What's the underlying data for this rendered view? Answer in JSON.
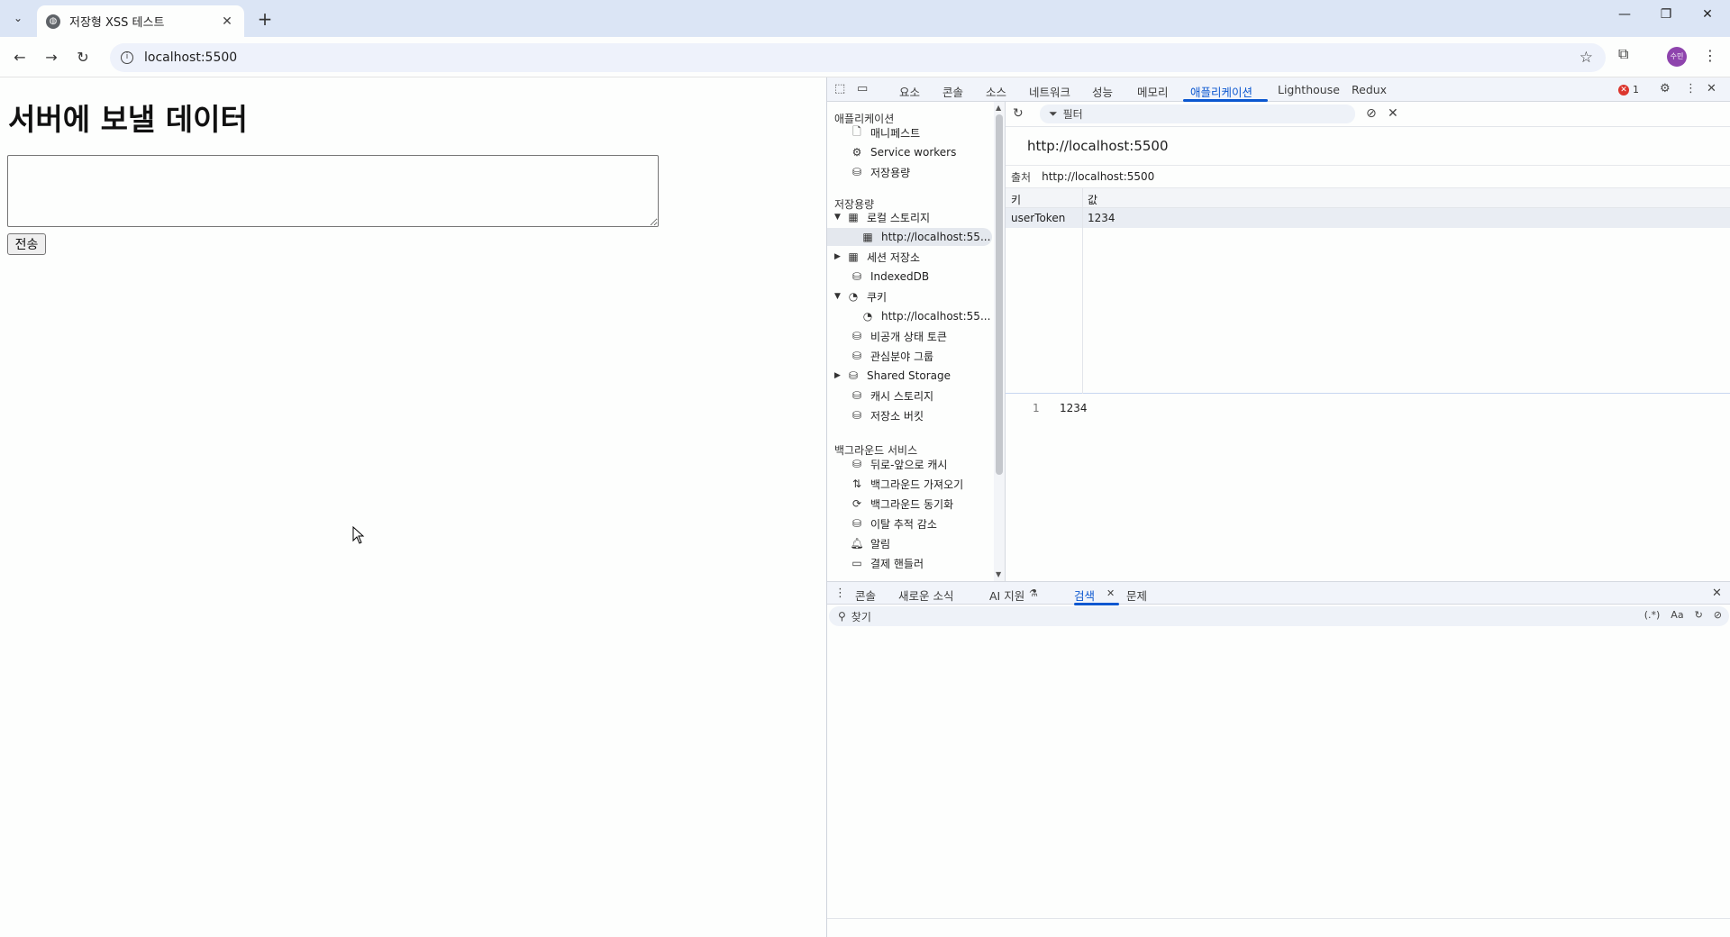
{
  "browser": {
    "tab_title": "저장형 XSS 테스트",
    "url": "localhost:5500"
  },
  "page": {
    "heading": "서버에 보낼 데이터",
    "textarea_value": "",
    "send_label": "전송"
  },
  "devtools": {
    "tabs": [
      "요소",
      "콘솔",
      "소스",
      "네트워크",
      "성능",
      "메모리",
      "애플리케이션",
      "Lighthouse",
      "Redux"
    ],
    "active_tab": "애플리케이션",
    "error_count": "1",
    "tree": {
      "section_app": "애플리케이션",
      "app_items": [
        "매니페스트",
        "Service workers",
        "저장용량"
      ],
      "section_storage": "저장용량",
      "local_storage": "로컬 스토리지",
      "local_storage_origin": "http://localhost:55...",
      "session_storage": "세션 저장소",
      "indexeddb": "IndexedDB",
      "cookies": "쿠키",
      "cookies_origin": "http://localhost:55...",
      "storage_items": [
        "비공개 상태 토큰",
        "관심분야 그룹",
        "Shared Storage",
        "캐시 스토리지",
        "저장소 버킷"
      ],
      "section_bg": "백그라운드 서비스",
      "bg_items": [
        "뒤로-앞으로 캐시",
        "백그라운드 가져오기",
        "백그라운드 동기화",
        "이탈 추적 감소",
        "알림",
        "결제 핸들러"
      ]
    },
    "filter_placeholder": "필터",
    "origin_title": "http://localhost:5500",
    "origin_label": "출처",
    "origin_value": "http://localhost:5500",
    "grid": {
      "key_header": "키",
      "value_header": "값",
      "rows": [
        {
          "key": "userToken",
          "value": "1234"
        }
      ]
    },
    "preview": {
      "line": "1",
      "value": "1234"
    },
    "drawer": {
      "tabs": [
        "콘솔",
        "새로운 소식",
        "AI 지원",
        "검색",
        "문제"
      ],
      "active_tab": "검색",
      "search_placeholder": "찾기",
      "regex_label": "(.*)",
      "case_label": "Aa"
    }
  },
  "colors": {
    "accent": "#0b57d0",
    "error": "#dc362e",
    "profile": "#8e44ad"
  },
  "icons": [
    "search-icon",
    "close-icon",
    "plus-icon",
    "back-arrow-icon",
    "forward-arrow-icon",
    "reload-icon",
    "info-icon",
    "star-icon",
    "extensions-icon",
    "kebab-menu-icon",
    "inspect-icon",
    "device-icon",
    "gear-icon",
    "file-icon",
    "database-icon",
    "table-icon",
    "cookie-icon",
    "bell-icon",
    "card-icon",
    "filter-icon",
    "block-icon"
  ]
}
